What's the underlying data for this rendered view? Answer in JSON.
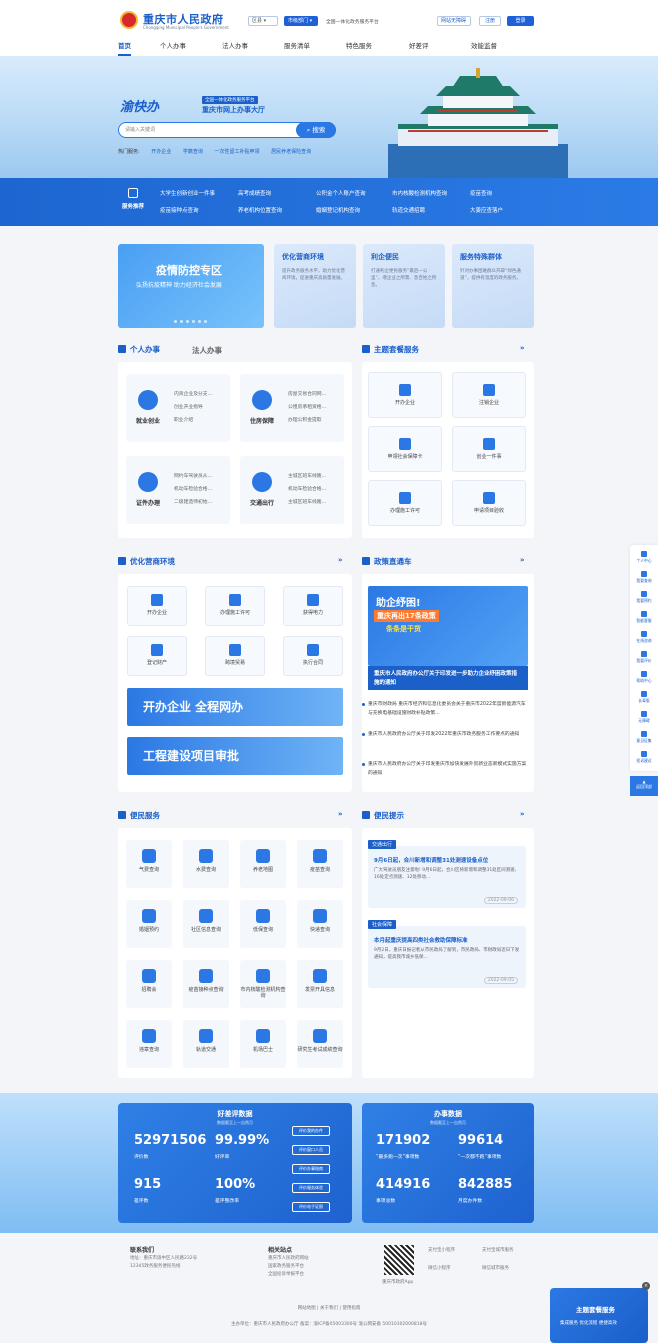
{
  "header": {
    "site_title": "重庆市人民政府",
    "site_sub": "Chongqing Municipal People's Government",
    "district_select": "区县",
    "dept_select": "市级部门",
    "platform_label": "全国一体化政务服务平台",
    "accessibility": "网站无障碍",
    "register": "注册",
    "login": "登录"
  },
  "nav": [
    "首页",
    "个人办事",
    "法人办事",
    "服务清单",
    "特色服务",
    "好差评",
    "效能监督"
  ],
  "banner": {
    "logo_text": "渝快办",
    "tag1": "全国一体化政务服务平台",
    "tag2": "重庆市网上办事大厅",
    "search_placeholder": "请输入关键词",
    "search_button": "搜索",
    "hot_label": "热门服务:",
    "hot_words": [
      "开办企业",
      "学籍查询",
      "一次性留工补贴申领",
      "居民养老保险查询"
    ]
  },
  "recommend": {
    "title": "服务推荐",
    "items": [
      "大学生创新创业一件事",
      "高考成绩查询",
      "公积金个人账户查询",
      "市内核酸检测机构查询",
      "疫苗查询",
      "疫苗接种点查询",
      "养老机构位置查询",
      "婚姻登记机构查询",
      "轨道交通招聘",
      "大姜应查落户"
    ]
  },
  "promo": {
    "epidemic_title": "疫情防控专区",
    "epidemic_sub": "弘扬抗疫精神 助力经济社会发展",
    "cards": [
      {
        "title": "优化营商环境",
        "desc": "提升政务服务水平，助力优化营商环境，促进重庆高质量发展。"
      },
      {
        "title": "利企便民",
        "desc": "打通利企便民服务“最后一公里”，增企业之所需、急百姓之所急。"
      },
      {
        "title": "服务特殊群体",
        "desc": "针对办事困难群众开辟“绿色通道”，提供有温度的政务服务。"
      }
    ]
  },
  "personal": {
    "tab_personal": "个人办事",
    "tab_legal": "法人办事",
    "cards": [
      {
        "name": "就业创业",
        "lines": [
          "内资企业及分支...",
          "创业开业指导",
          "职业介绍"
        ]
      },
      {
        "name": "住房保障",
        "lines": [
          "房屋交易合同网...",
          "公租房承租资格...",
          "办理公积金提取"
        ]
      },
      {
        "name": "证件办理",
        "lines": [
          "网约车驾驶员从...",
          "机动车检验合格...",
          "二级建造师初始..."
        ]
      },
      {
        "name": "交通出行",
        "lines": [
          "主城区班车线路...",
          "机动车检验合格...",
          "主城区班车线路..."
        ]
      }
    ]
  },
  "theme": {
    "title": "主题套餐服务",
    "tiles": [
      "开办企业",
      "注销企业",
      "申领社会保障卡",
      "创业一件事",
      "办理施工许可",
      "申请项目验收"
    ]
  },
  "business": {
    "title": "优化营商环境",
    "tiles": [
      "开办企业",
      "办理施工许可",
      "获得电力",
      "登记财产",
      "跨境贸易",
      "执行合同"
    ],
    "banner1": "开办企业 全程网办",
    "banner2": "工程建设项目审批"
  },
  "policy": {
    "title": "政策直通车",
    "img_title": "助企纾困!",
    "img_sub": "重庆再出17条政策",
    "img_tag": "条条是干货",
    "img_caption": "重庆市人民政府办公厅关于印发进一步助力企业纾困政策措施的通知",
    "news": [
      "重庆市财政局 重庆市经济和信息化委员会关于重庆市2022年度新能源汽车与充换电基础设施财政补贴政策...",
      "重庆市人民政府办公厅关于印发2022年重庆市政务服务工作要点的通知",
      "重庆市人民政府办公厅关于印发重庆市加快发展外贸新业态新模式实施方案的通知"
    ]
  },
  "life": {
    "title": "便民服务",
    "tiles": [
      "气费查询",
      "水费查询",
      "养老地图",
      "疫苗查询",
      "婚姻预约",
      "社区信息查询",
      "低保查询",
      "快递查询",
      "招聘会",
      "疫苗接种点查询",
      "市内核酸检测机构查询",
      "发票开具信息",
      "违章查询",
      "轨道交通",
      "机场巴士",
      "研究生考试成绩查询"
    ]
  },
  "tips": {
    "title": "便民提示",
    "cards": [
      {
        "tag": "交通出行",
        "headline": "9月6日起，合川新增和调整31处测速设备点位",
        "desc": "广大驾驶员朋友注意啦! 9月6日起，合川区将新增和调整31处区间测速、16处定点测速、12处移动...",
        "date": "2022-09-06"
      },
      {
        "tag": "社会保障",
        "headline": "本月起重庆提高四类社会救助保障标准",
        "desc": "9月2日，重庆日报记者从市民政局了解到，市民政局、市财政局近日下发通知，提高我市城乡低保...",
        "date": "2022-09-05"
      }
    ]
  },
  "stats": {
    "eval_title": "好差评数据",
    "eval_sub": "数据截至上一自然月",
    "eval": [
      {
        "num": "52971506",
        "lbl": "评价数"
      },
      {
        "num": "99.99%",
        "lbl": "好评率"
      },
      {
        "num": "915",
        "lbl": "差评数"
      },
      {
        "num": "100%",
        "lbl": "差评整改率"
      }
    ],
    "eval_buttons": [
      "评价我的办件",
      "评价窗口人员",
      "评价办事指南",
      "评价服务体验",
      "评价电子证照"
    ],
    "work_title": "办事数据",
    "work_sub": "数据截至上一自然月",
    "work": [
      {
        "num": "171902",
        "lbl": "“最多跑一次”事项数"
      },
      {
        "num": "99614",
        "lbl": "“一次都不跑”事项数"
      },
      {
        "num": "414916",
        "lbl": "事项总数"
      },
      {
        "num": "842885",
        "lbl": "月度办件数"
      }
    ]
  },
  "footer": {
    "contact_title": "联系我们",
    "contact_lines": [
      "地址：重庆市渝中区人民路232号",
      "12345政务服务便民热线"
    ],
    "links_title": "相关站点",
    "links": [
      "重庆市人民政府网站",
      "国家政务服务平台",
      "全国投诉举报平台"
    ],
    "qr_label": "重庆市政府App",
    "apps": [
      "支付宝小程序",
      "支付宝城市服务",
      "微信小程序",
      "微信城市服务"
    ],
    "bottom_links": "网站地图 | 关于我们 | 使用指南",
    "sponsor": "主办单位：重庆市人民政府办公厅 备案：渝ICP备05003300号 渝公网安备 50010302000818号"
  },
  "sidebar": [
    "个人中心",
    "我要查询",
    "我要预约",
    "智能客服",
    "在线咨询",
    "我要评价",
    "帮助中心",
    "长辈版",
    "无障碍",
    "意见征集",
    "投诉建议"
  ],
  "to_top": "返回顶部",
  "float_ad": {
    "title": "主题套餐服务",
    "sub": "集成服务 优化流程 便捷高效"
  },
  "colors": {
    "primary": "#1b5fc9",
    "accent": "#2b78e4"
  }
}
